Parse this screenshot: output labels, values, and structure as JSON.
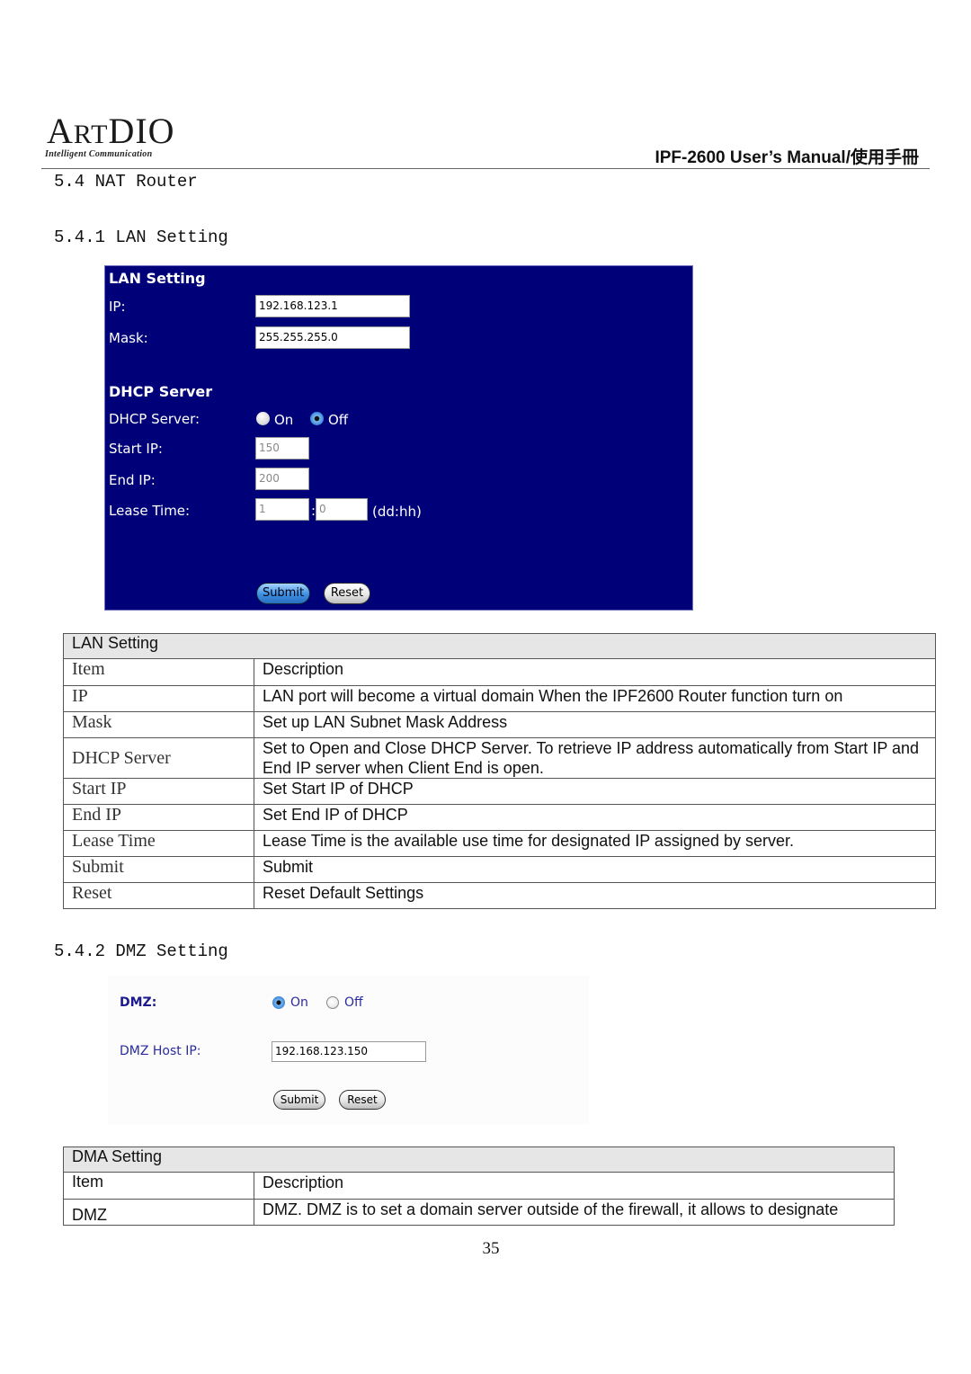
{
  "header": {
    "logo_text_a": "A",
    "logo_text_rt": "RT",
    "logo_text_d": "D",
    "logo_text_io": "IO",
    "logo_tagline": "Intelligent Communication",
    "manual_title": "IPF-2600 User’s Manual/使用手冊"
  },
  "sections": {
    "nat_router": "5.4 NAT Router",
    "lan_setting": "5.4.1 LAN Setting",
    "dmz_setting": "5.4.2 DMZ Setting"
  },
  "lan_panel": {
    "title": "LAN Setting",
    "ip_label": "IP:",
    "ip_value": "192.168.123.1",
    "mask_label": "Mask:",
    "mask_value": "255.255.255.0",
    "dhcp_title": "DHCP Server",
    "dhcp_label": "DHCP Server:",
    "dhcp_on_label": "On",
    "dhcp_off_label": "Off",
    "dhcp_selected": "Off",
    "start_ip_label": "Start IP:",
    "start_ip_value": "150",
    "end_ip_label": "End IP:",
    "end_ip_value": "200",
    "lease_label": "Lease Time:",
    "lease_days": "1",
    "lease_sep": ":",
    "lease_hours": "0",
    "lease_unit": "(dd:hh)",
    "submit_label": "Submit",
    "reset_label": "Reset"
  },
  "lan_table": {
    "caption": "LAN Setting",
    "header": {
      "item": "Item",
      "description": "Description"
    },
    "rows": [
      {
        "item": "IP",
        "description": "LAN port will become a virtual domain When the IPF2600 Router function turn on"
      },
      {
        "item": "Mask",
        "description": "Set up LAN Subnet Mask Address"
      },
      {
        "item": "DHCP Server",
        "description": "Set to Open and Close DHCP Server. To retrieve IP address automatically from Start IP and End IP server when Client End is open."
      },
      {
        "item": "Start IP",
        "description": "Set Start IP of DHCP"
      },
      {
        "item": "End IP",
        "description": "Set End IP of DHCP"
      },
      {
        "item": "Lease Time",
        "description": "Lease Time is the available use time for designated IP assigned by server."
      },
      {
        "item": "Submit",
        "description": "Submit"
      },
      {
        "item": "Reset",
        "description": "Reset Default Settings"
      }
    ]
  },
  "dmz_panel": {
    "dmz_label": "DMZ:",
    "on_label": "On",
    "off_label": "Off",
    "selected": "On",
    "host_ip_label": "DMZ Host IP:",
    "host_ip_value": "192.168.123.150",
    "submit_label": "Submit",
    "reset_label": "Reset"
  },
  "dmz_table": {
    "caption": "DMA Setting",
    "header": {
      "item": "Item",
      "description": "Description"
    },
    "rows": [
      {
        "item": "DMZ",
        "description": "DMZ. DMZ is to set a domain server outside of the firewall, it allows to designate"
      }
    ]
  },
  "page_number": "35",
  "colors": {
    "lan_panel_bg": "#000078",
    "table_caption_bg": "#e6e6e6",
    "dmz_text": "#2a2aa0"
  }
}
